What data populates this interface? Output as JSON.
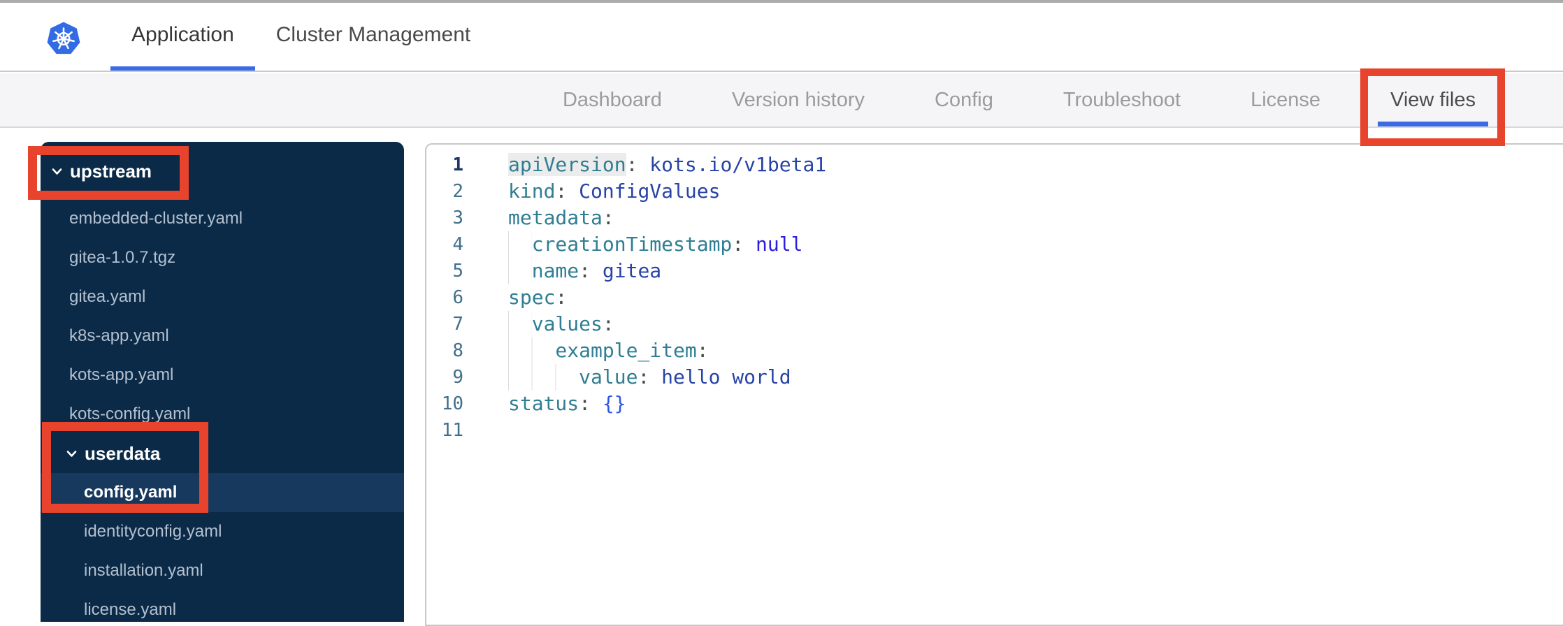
{
  "colors": {
    "annotation": "#e8432c",
    "active_tab_underline": "#3a6be4",
    "logo_blue": "#326ce5",
    "nav_bg": "#f5f5f8",
    "sidebar_bg": "#0b2a47",
    "sidebar_selected_bg": "#17395d",
    "sidebar_file_text": "#b3c0cf",
    "code_key": "#2f7e93",
    "code_punct": "#4a4a4a",
    "code_value": "#2743a6",
    "code_constant": "#2b1fe0",
    "code_brace": "#2e55e8",
    "line_number": "#41708c"
  },
  "topbar": {
    "tabs": [
      {
        "label": "Application",
        "active": true
      },
      {
        "label": "Cluster Management",
        "active": false
      }
    ]
  },
  "nav": {
    "items": [
      {
        "label": "Dashboard",
        "active": false
      },
      {
        "label": "Version history",
        "active": false
      },
      {
        "label": "Config",
        "active": false
      },
      {
        "label": "Troubleshoot",
        "active": false
      },
      {
        "label": "License",
        "active": false
      },
      {
        "label": "View files",
        "active": true
      }
    ]
  },
  "file_tree": {
    "items": [
      {
        "label": "upstream",
        "type": "folder",
        "indent": 0,
        "expanded": true,
        "selected": false
      },
      {
        "label": "embedded-cluster.yaml",
        "type": "file",
        "indent": 0,
        "selected": false
      },
      {
        "label": "gitea-1.0.7.tgz",
        "type": "file",
        "indent": 0,
        "selected": false
      },
      {
        "label": "gitea.yaml",
        "type": "file",
        "indent": 0,
        "selected": false
      },
      {
        "label": "k8s-app.yaml",
        "type": "file",
        "indent": 0,
        "selected": false
      },
      {
        "label": "kots-app.yaml",
        "type": "file",
        "indent": 0,
        "selected": false
      },
      {
        "label": "kots-config.yaml",
        "type": "file",
        "indent": 0,
        "selected": false
      },
      {
        "label": "userdata",
        "type": "folder",
        "indent": 1,
        "expanded": true,
        "selected": false
      },
      {
        "label": "config.yaml",
        "type": "file",
        "indent": 1,
        "selected": true
      },
      {
        "label": "identityconfig.yaml",
        "type": "file",
        "indent": 1,
        "selected": false
      },
      {
        "label": "installation.yaml",
        "type": "file",
        "indent": 1,
        "selected": false
      },
      {
        "label": "license.yaml",
        "type": "file",
        "indent": 1,
        "selected": false
      }
    ]
  },
  "editor": {
    "language": "yaml",
    "lines": [
      {
        "num": "1",
        "indent": 0,
        "active": true,
        "tokens": [
          {
            "t": "key",
            "v": "apiVersion",
            "hl": true
          },
          {
            "t": "punct",
            "v": ": "
          },
          {
            "t": "val",
            "v": "kots.io/v1beta1"
          }
        ]
      },
      {
        "num": "2",
        "indent": 0,
        "tokens": [
          {
            "t": "key",
            "v": "kind"
          },
          {
            "t": "punct",
            "v": ": "
          },
          {
            "t": "val",
            "v": "ConfigValues"
          }
        ]
      },
      {
        "num": "3",
        "indent": 0,
        "tokens": [
          {
            "t": "key",
            "v": "metadata"
          },
          {
            "t": "punct",
            "v": ":"
          }
        ]
      },
      {
        "num": "4",
        "indent": 2,
        "tokens": [
          {
            "t": "key",
            "v": "  creationTimestamp"
          },
          {
            "t": "punct",
            "v": ": "
          },
          {
            "t": "const",
            "v": "null"
          }
        ]
      },
      {
        "num": "5",
        "indent": 2,
        "tokens": [
          {
            "t": "key",
            "v": "  name"
          },
          {
            "t": "punct",
            "v": ": "
          },
          {
            "t": "val",
            "v": "gitea"
          }
        ]
      },
      {
        "num": "6",
        "indent": 0,
        "tokens": [
          {
            "t": "key",
            "v": "spec"
          },
          {
            "t": "punct",
            "v": ":"
          }
        ]
      },
      {
        "num": "7",
        "indent": 2,
        "tokens": [
          {
            "t": "key",
            "v": "  values"
          },
          {
            "t": "punct",
            "v": ":"
          }
        ]
      },
      {
        "num": "8",
        "indent": 4,
        "tokens": [
          {
            "t": "key",
            "v": "    example_item"
          },
          {
            "t": "punct",
            "v": ":"
          }
        ]
      },
      {
        "num": "9",
        "indent": 6,
        "tokens": [
          {
            "t": "key",
            "v": "      value"
          },
          {
            "t": "punct",
            "v": ": "
          },
          {
            "t": "val",
            "v": "hello world"
          }
        ]
      },
      {
        "num": "10",
        "indent": 0,
        "tokens": [
          {
            "t": "key",
            "v": "status"
          },
          {
            "t": "punct",
            "v": ": "
          },
          {
            "t": "brace",
            "v": "{}"
          }
        ]
      },
      {
        "num": "11",
        "indent": 0,
        "tokens": []
      }
    ]
  }
}
